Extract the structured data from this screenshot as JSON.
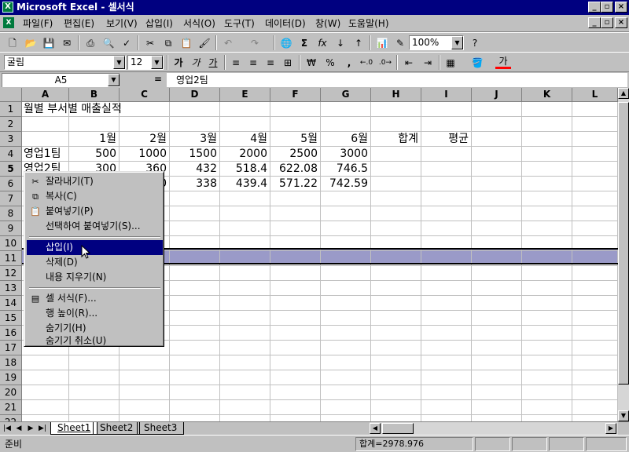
{
  "window": {
    "title": "Microsoft Excel - 셀서식",
    "controls": {
      "minimize": "_",
      "maximize": "▫",
      "close": "×"
    }
  },
  "menubar": {
    "items": [
      "파일(F)",
      "편집(E)",
      "보기(V)",
      "삽입(I)",
      "서식(O)",
      "도구(T)",
      "데이터(D)",
      "창(W)",
      "도움말(H)"
    ]
  },
  "toolbar": {
    "zoom": "100%",
    "font_name": "굴림",
    "font_size": "12",
    "bold_glyph": "가",
    "italic_glyph": "가",
    "underline_glyph": "가",
    "currency_glyph": "₩",
    "percent_glyph": "%",
    "comma_glyph": ",",
    "font_color_glyph": "가"
  },
  "formula_bar": {
    "name_box": "A5",
    "equals": "=",
    "content": "영업2팀"
  },
  "sheet": {
    "columns": [
      "A",
      "B",
      "C",
      "D",
      "E",
      "F",
      "G",
      "H",
      "I",
      "J",
      "K",
      "L"
    ],
    "rows": [
      "1",
      "2",
      "3",
      "4",
      "5",
      "6",
      "7",
      "8",
      "9",
      "10",
      "11",
      "12",
      "13",
      "14",
      "15",
      "16",
      "17",
      "18",
      "19",
      "20",
      "21",
      "22"
    ],
    "active_row": "5",
    "active_col": "A",
    "cells": {
      "A1": "월별 부서별 매출실적",
      "B3": "1월",
      "C3": "2월",
      "D3": "3월",
      "E3": "4월",
      "F3": "5월",
      "G3": "6월",
      "H3": "합계",
      "I3": "평균",
      "A4": "영업1팀",
      "B4": "500",
      "C4": "1000",
      "D4": "1500",
      "E4": "2000",
      "F4": "2500",
      "G4": "3000",
      "A5": "영업2팀",
      "B5": "300",
      "C5": "360",
      "D5": "432",
      "E5": "518.4",
      "F5": "622.08",
      "G5": "746.5",
      "C6": "0",
      "D6": "338",
      "E6": "439.4",
      "F6": "571.22",
      "G6": "742.59"
    }
  },
  "context_menu": {
    "items": [
      {
        "label": "잘라내기(T)",
        "icon": "scissors-icon"
      },
      {
        "label": "복사(C)",
        "icon": "copy-icon"
      },
      {
        "label": "붙여넣기(P)",
        "icon": "paste-icon"
      },
      {
        "label": "선택하여 붙여넣기(S)...",
        "icon": ""
      },
      {
        "label": "삽입(I)",
        "icon": "",
        "highlighted": true
      },
      {
        "label": "삭제(D)",
        "icon": ""
      },
      {
        "label": "내용 지우기(N)",
        "icon": ""
      },
      {
        "label": "셀 서식(F)...",
        "icon": "format-cells-icon"
      },
      {
        "label": "행 높이(R)...",
        "icon": ""
      },
      {
        "label": "숨기기(H)",
        "icon": ""
      },
      {
        "label": "숨기기 취소(U)",
        "icon": ""
      }
    ]
  },
  "sheet_tabs": [
    "Sheet1",
    "Sheet2",
    "Sheet3"
  ],
  "status": {
    "text": "준비",
    "sum": "합계=2978.976"
  },
  "colors": {
    "title_bar": "#000080",
    "selected_row": "#9a9ac8",
    "menu_highlight": "#000080"
  }
}
